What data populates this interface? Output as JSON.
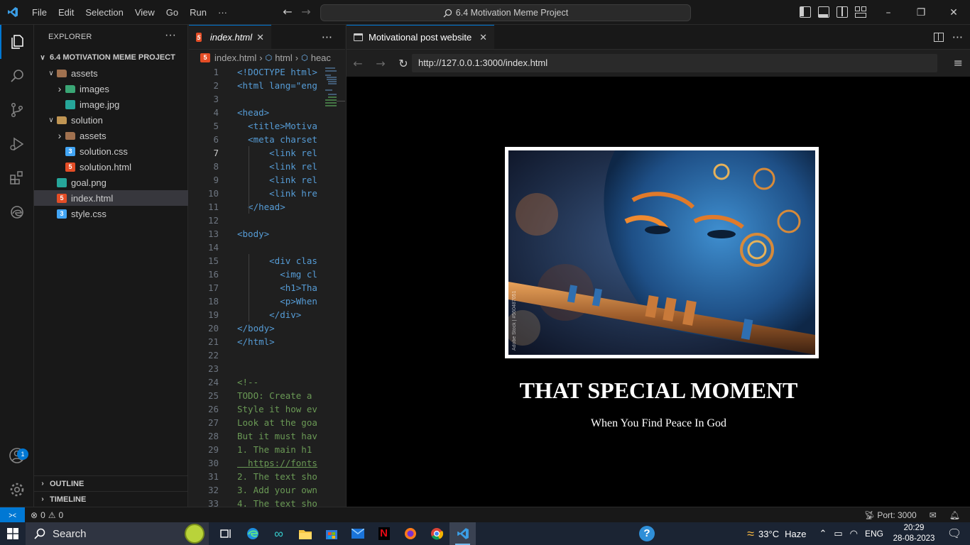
{
  "menu": [
    "File",
    "Edit",
    "Selection",
    "View",
    "Go",
    "Run",
    "···"
  ],
  "command_center": "6.4 Motivation Meme Project",
  "explorer": {
    "title": "EXPLORER",
    "more": "···",
    "project": "6.4 MOTIVATION MEME PROJECT",
    "tree": [
      {
        "label": "assets",
        "depth": 1,
        "kind": "assets",
        "twisty": "open"
      },
      {
        "label": "images",
        "depth": 2,
        "kind": "images",
        "twisty": "closed"
      },
      {
        "label": "image.jpg",
        "depth": 2,
        "kind": "img",
        "twisty": ""
      },
      {
        "label": "solution",
        "depth": 1,
        "kind": "folder",
        "twisty": "open"
      },
      {
        "label": "assets",
        "depth": 2,
        "kind": "assets",
        "twisty": "closed"
      },
      {
        "label": "solution.css",
        "depth": 2,
        "kind": "css",
        "twisty": ""
      },
      {
        "label": "solution.html",
        "depth": 2,
        "kind": "html",
        "twisty": ""
      },
      {
        "label": "goal.png",
        "depth": 1,
        "kind": "img",
        "twisty": ""
      },
      {
        "label": "index.html",
        "depth": 1,
        "kind": "html",
        "twisty": "",
        "selected": true
      },
      {
        "label": "style.css",
        "depth": 1,
        "kind": "css",
        "twisty": ""
      }
    ],
    "outline": "OUTLINE",
    "timeline": "TIMELINE"
  },
  "editor": {
    "tab_label": "index.html",
    "breadcrumb": [
      "index.html",
      "html",
      "heac"
    ],
    "current_line": 7,
    "lines": [
      {
        "n": "1",
        "t": "<!DOCTYPE html>"
      },
      {
        "n": "2",
        "t": "<html lang=\"eng"
      },
      {
        "n": "3",
        "t": ""
      },
      {
        "n": "4",
        "t": "<head>"
      },
      {
        "n": "5",
        "t": "  <title>Motiva"
      },
      {
        "n": "6",
        "t": "  <meta charset"
      },
      {
        "n": "7",
        "t": "      <link rel"
      },
      {
        "n": "8",
        "t": "      <link rel"
      },
      {
        "n": "9",
        "t": "      <link rel"
      },
      {
        "n": "10",
        "t": "      <link hre"
      },
      {
        "n": "11",
        "t": "  </head>"
      },
      {
        "n": "12",
        "t": ""
      },
      {
        "n": "13",
        "t": "<body>"
      },
      {
        "n": "14",
        "t": ""
      },
      {
        "n": "15",
        "t": "      <div clas"
      },
      {
        "n": "16",
        "t": "        <img cl"
      },
      {
        "n": "17",
        "t": "        <h1>Tha"
      },
      {
        "n": "18",
        "t": "        <p>When"
      },
      {
        "n": "19",
        "t": "      </div>"
      },
      {
        "n": "20",
        "t": "</body>"
      },
      {
        "n": "21",
        "t": "</html>"
      },
      {
        "n": "22",
        "t": ""
      },
      {
        "n": "23",
        "t": ""
      },
      {
        "n": "24",
        "t": "<!--"
      },
      {
        "n": "25",
        "t": "TODO: Create a"
      },
      {
        "n": "26",
        "t": "Style it how ev"
      },
      {
        "n": "27",
        "t": "Look at the goa"
      },
      {
        "n": "28",
        "t": "But it must hav"
      },
      {
        "n": "29",
        "t": "1. The main h1"
      },
      {
        "n": "30",
        "t": "  https://fonts"
      },
      {
        "n": "31",
        "t": "2. The text sho"
      },
      {
        "n": "32",
        "t": "3. Add your own"
      },
      {
        "n": "33",
        "t": "4. The text sho"
      }
    ]
  },
  "browser": {
    "tab_label": "Motivational post website",
    "url": "http://127.0.0.1:3000/index.html",
    "page": {
      "heading": "THAT SPECIAL MOMENT",
      "subtext": "When You Find Peace In God",
      "image_watermark": "Adobe Stock | #560487051"
    }
  },
  "status": {
    "errors": "0",
    "warnings": "0",
    "port": "Port: 3000"
  },
  "taskbar": {
    "search_placeholder": "Search",
    "weather_temp": "33°C",
    "weather_text": "Haze",
    "lang": "ENG",
    "time": "20:29",
    "date": "28-08-2023"
  },
  "account_badge": "1",
  "colors": {
    "accent": "#0078d4",
    "page_bg": "#000000"
  }
}
